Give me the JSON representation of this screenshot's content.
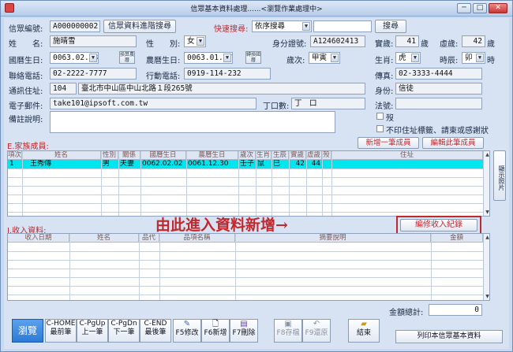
{
  "window": {
    "title": "信眾基本資料處理......<瀏覽作業處理中>",
    "min": "─",
    "max": "□",
    "close": "✕"
  },
  "top": {
    "member_no_label": "信眾編號:",
    "member_no": "A000000002",
    "advanced_search": "信眾資料進階搜尋",
    "quick_search_label": "快速搜尋:",
    "quick_search_option": "依序搜尋",
    "search_btn": "搜尋",
    "name_label": "姓　　名:",
    "name": "施晴雪",
    "gender_label": "性　　別:",
    "gender": "女",
    "id_label": "身分證號:",
    "id": "A124602413",
    "age_label": "實歲:",
    "age": "41",
    "age_unit": "歲",
    "virtual_age_label": "虛歲:",
    "virtual_age": "42",
    "virtual_age_unit": "歲",
    "birth_label": "國曆生日:",
    "birth": "0063.02.08",
    "lunar_label": "農曆生日:",
    "lunar": "0063.01.17",
    "convert_btn_1": "換算農曆",
    "convert_btn_2": "轉換國曆",
    "ganzhi_label": "歲次:",
    "ganzhi": "甲寅",
    "zodiac_label": "生肖:",
    "zodiac": "虎",
    "hour_label": "時辰:",
    "hour": "卯",
    "hour_unit": "時",
    "phone_label": "聯絡電話:",
    "phone": "02-2222-7777",
    "mobile_label": "行動電話:",
    "mobile": "0919-114-232",
    "fax_label": "傳真:",
    "fax": "02-3333-4444",
    "addr_label": "通訊住址:",
    "zip": "104",
    "addr": "臺北市中山區中山北路１段265號",
    "identity_label": "身份:",
    "identity": "信徒",
    "email_label": "電子郵件:",
    "email": "take101@ipsoft.com.tw",
    "dings_label": "丁口數:",
    "dings": "丁　口",
    "dharma_label": "法號:",
    "dharma": "",
    "note_label": "備註說明:",
    "note": "",
    "death_label": "歿",
    "noprint_label": "不印住址標籤、請柬或感謝狀"
  },
  "family": {
    "title": "E.家族成員:",
    "add_btn": "新增一筆成員",
    "edit_btn": "編輯此筆成員",
    "side_btn": "顯示照片",
    "headers": [
      "項次",
      "姓名",
      "性別",
      "關係",
      "國曆生日",
      "農曆生日",
      "歲次",
      "生肖",
      "生辰",
      "實歲",
      "虛歲",
      "殁",
      "住址"
    ],
    "rows": [
      {
        "idx": "1",
        "name": "王秀傳",
        "gender": "男",
        "rel": "夫妻",
        "birth": "0062.02.02",
        "lunar": "0061.12.30",
        "ganzhi": "壬子",
        "zodiac": "鼠",
        "hour": "巳",
        "age": "42",
        "vage": "44",
        "dead": "",
        "addr": ""
      }
    ]
  },
  "income": {
    "title": "I.收入資料:",
    "annotation": "由此進入資料新增→",
    "edit_btn": "編修收入紀錄",
    "headers": [
      "收入日期",
      "姓名",
      "品代",
      "品項名稱",
      "摘要說明",
      "金額"
    ],
    "total_label": "金額總計:",
    "total": "0"
  },
  "footer": {
    "browse": "瀏覽",
    "first": [
      "C-HOME",
      "最前筆"
    ],
    "prev": [
      "C-PgUp",
      "上一筆"
    ],
    "next": [
      "C-PgDn",
      "下一筆"
    ],
    "last": [
      "C-END",
      "最後筆"
    ],
    "edit": "F5修改",
    "add": "F6新增",
    "del": "F7刪除",
    "save": "F8存檔",
    "restore": "F9還原",
    "close": "結束",
    "print": "列印本信眾基本資料"
  },
  "colors": {
    "accent_red": "#c0282e",
    "selected_row": "#00e6ee",
    "browse_btn": "#2b7bd6"
  }
}
